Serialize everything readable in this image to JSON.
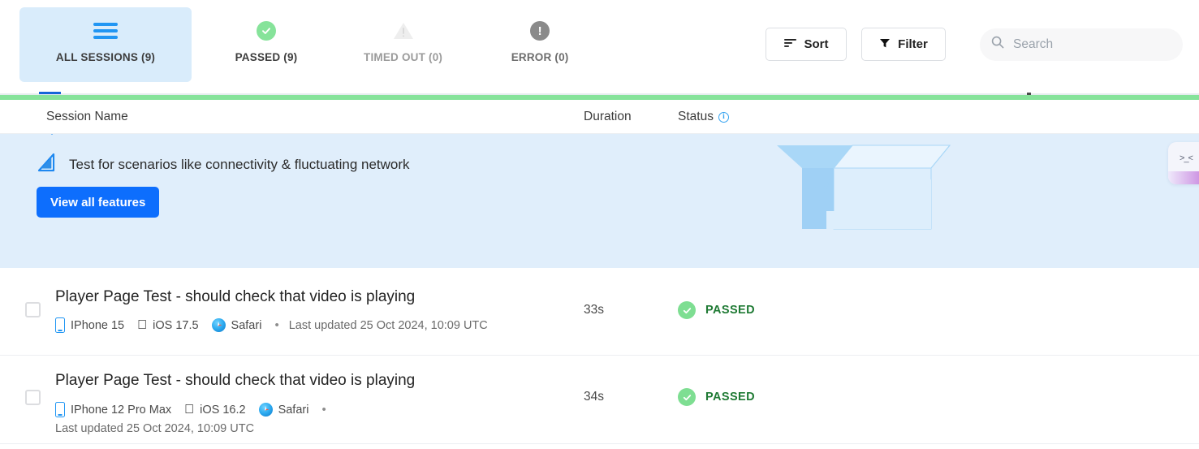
{
  "toolbar": {
    "tabs": [
      {
        "id": "all-sessions",
        "label": "ALL SESSIONS (9)",
        "icon": "hamburger-icon",
        "active": true
      },
      {
        "id": "passed",
        "label": "PASSED (9)",
        "icon": "circle-check-icon",
        "active": false
      },
      {
        "id": "timed-out",
        "label": "TIMED OUT (0)",
        "icon": "warning-triangle-icon",
        "active": false
      },
      {
        "id": "error",
        "label": "ERROR (0)",
        "icon": "circle-exclamation-icon",
        "active": false
      }
    ],
    "sort_label": "Sort",
    "filter_label": "Filter",
    "search_placeholder": "Search",
    "search_value": ""
  },
  "table": {
    "columns": {
      "session_name": "Session Name",
      "duration": "Duration",
      "status": "Status",
      "status_info_glyph": "i"
    }
  },
  "promo": {
    "headline": "Test for scenarios like connectivity & fluctuating network",
    "cta_label": "View all features",
    "icon": "network-signal-icon",
    "art": "open-box-illustration",
    "widget_face": ">_<"
  },
  "sessions": [
    {
      "title": "Player Page Test - should check that video is playing",
      "device": "IPhone 15",
      "os": "iOS 17.5",
      "browser": "Safari",
      "separator": "•",
      "last_updated": "Last updated 25 Oct 2024, 10:09 UTC",
      "duration": "33s",
      "status": "PASSED",
      "status_color": "#1f7a34",
      "wrapped": false
    },
    {
      "title": "Player Page Test - should check that video is playing",
      "device": "IPhone 12 Pro Max",
      "os": "iOS 16.2",
      "browser": "Safari",
      "separator": "•",
      "last_updated": "Last updated 25 Oct 2024, 10:09 UTC",
      "duration": "34s",
      "status": "PASSED",
      "status_color": "#1f7a34",
      "wrapped": true
    }
  ],
  "colors": {
    "accent_blue": "#2196f3",
    "cta_blue": "#0d6efd",
    "active_tab_bg": "#d9ecfb",
    "promo_bg": "#e0eefb",
    "pass_green": "#7ede92",
    "pass_text_green": "#1f7a34",
    "progress_green": "#86e39a"
  }
}
